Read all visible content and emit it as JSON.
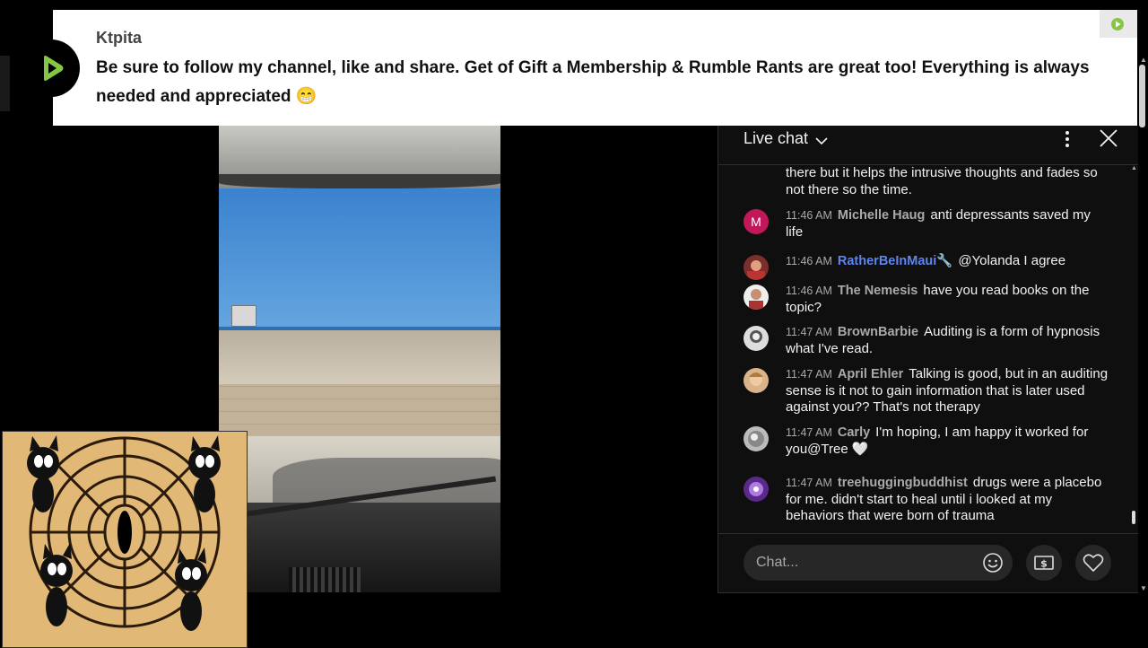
{
  "banner": {
    "username": "Ktpita",
    "message": "Be sure to follow my channel, like and share. Get of Gift a Membership & Rumble Rants are great too! Everything is always needed and appreciated 😁"
  },
  "chat": {
    "title": "Live chat",
    "partial_top_text": "there but it helps the intrusive thoughts and fades so not there so the time.",
    "messages": [
      {
        "time": "11:46 AM",
        "author": "Michelle Haug",
        "text": "anti depressants saved my life",
        "avatar": "M"
      },
      {
        "time": "11:46 AM",
        "author": "RatherBeInMaui🔧",
        "text": "@Yolanda I agree",
        "avatar": ""
      },
      {
        "time": "11:46 AM",
        "author": "The Nemesis",
        "text": "have you read books on the topic?",
        "avatar": ""
      },
      {
        "time": "11:47 AM",
        "author": "BrownBarbie",
        "text": "Auditing is a form of hypnosis what I've read.",
        "avatar": ""
      },
      {
        "time": "11:47 AM",
        "author": "April Ehler",
        "text": "Talking is good, but in an auditing sense is it not to gain information that is later used against you?? That's not therapy",
        "avatar": ""
      },
      {
        "time": "11:47 AM",
        "author": "Carly",
        "text": "I'm hoping, I am happy it worked for you@Tree 🤍",
        "avatar": ""
      },
      {
        "time": "11:47 AM",
        "author": "treehuggingbuddhist",
        "text": "drugs were a placebo for me. didn't start to heal until i looked at my behaviors that were born of trauma",
        "avatar": ""
      }
    ],
    "input_placeholder": "Chat..."
  },
  "icons": {
    "banner_logo": "rumble-icon",
    "chevron": "chevron-down-icon",
    "menu": "more-vert-icon",
    "close": "close-icon",
    "emoji": "emoji-icon",
    "rant": "dollar-icon",
    "heart": "heart-icon"
  },
  "colors": {
    "brand_green": "#85c742",
    "avatar_m": "#c2185b",
    "author_highlight": "#5e84f1"
  }
}
